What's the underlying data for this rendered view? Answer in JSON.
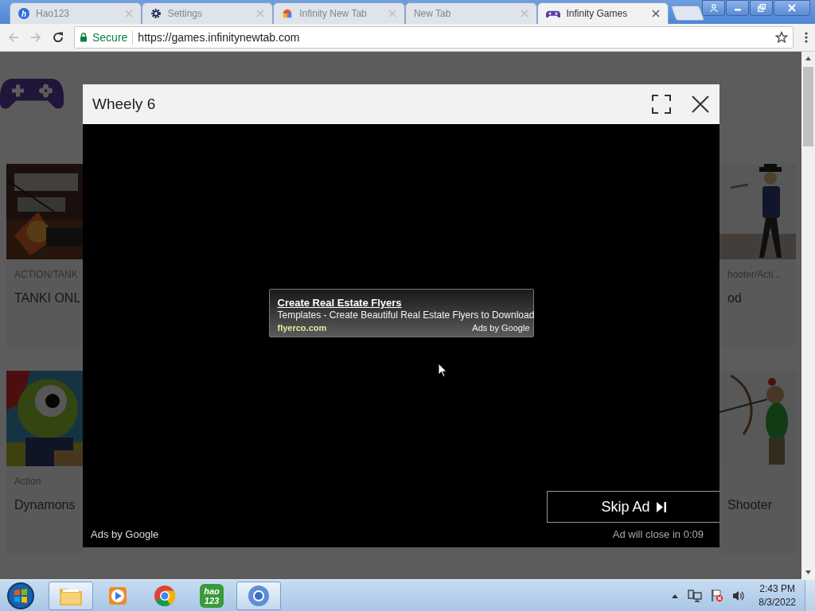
{
  "browser": {
    "tabs": [
      {
        "kind": "hao",
        "badge": "h",
        "title": "Hao123",
        "selected": false
      },
      {
        "kind": "gear",
        "title": "Settings",
        "selected": false
      },
      {
        "kind": "colorful",
        "title": "Infinity New Tab",
        "selected": false
      },
      {
        "kind": "none",
        "title": "New Tab",
        "selected": false
      },
      {
        "kind": "gamepad",
        "title": "Infinity Games",
        "selected": true
      }
    ],
    "address_bar": {
      "security_label": "Secure",
      "url": "https://games.infinitynewtab.com"
    }
  },
  "page": {
    "cards": [
      {
        "category": "ACTION/TANK",
        "title": "TANKI ONL"
      },
      {
        "category": "hooter/Acti...",
        "title": "od"
      },
      {
        "category": "Action",
        "title": "Dynamons"
      },
      {
        "title": "Shooter"
      }
    ]
  },
  "modal": {
    "title": "Wheely 6",
    "ad": {
      "headline": "Create Real Estate Flyers",
      "description": "Templates - Create Beautiful Real Estate Flyers to Download",
      "domain": "flyerco.com",
      "attribution": "Ads by Google"
    },
    "skip_button": "Skip Ad",
    "countdown": "Ad will close in 0:09",
    "attribution": "Ads by Google"
  },
  "taskbar": {
    "items": [
      {
        "kind": "explorer",
        "running": true
      },
      {
        "kind": "media",
        "running": false
      },
      {
        "kind": "chrome",
        "running": false
      },
      {
        "kind": "hao",
        "label": "hao 123",
        "running": false
      },
      {
        "kind": "chromium",
        "running": true
      }
    ],
    "clock": {
      "time": "2:43 PM",
      "date": "8/3/2022"
    }
  }
}
